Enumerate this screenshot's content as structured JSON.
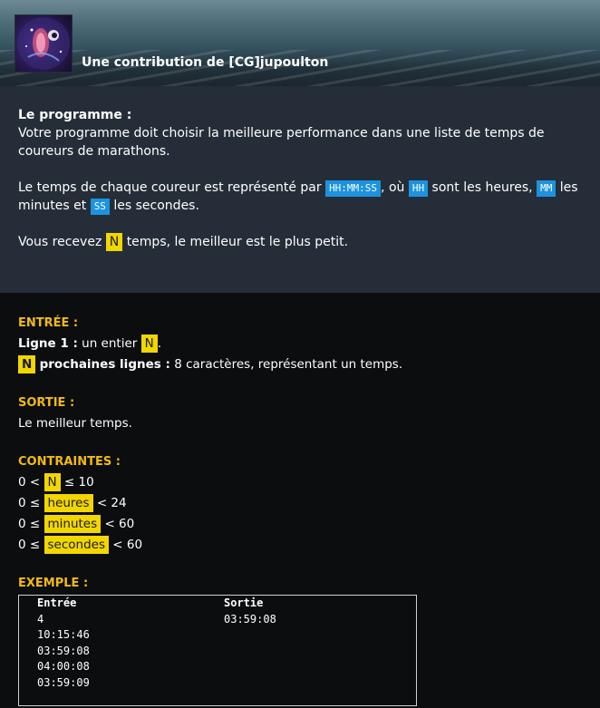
{
  "header": {
    "contribution": "Une contribution de [CG]jupoulton",
    "avatar_icon": "galaxy-creature-icon"
  },
  "statement": {
    "title": "Le programme :",
    "line1": "Votre programme doit choisir la meilleure performance dans une liste de temps de coureurs de marathons.",
    "p2_pre": "Le temps de chaque coureur est représenté par",
    "p2_code1": "HH:MM:SS",
    "p2_mid1": ", où",
    "p2_code2": "HH",
    "p2_mid2": "sont les heures,",
    "p2_code3": "MM",
    "p2_mid3": "les minutes et",
    "p2_code4": "SS",
    "p2_end": "les secondes.",
    "p3_pre": "Vous recevez",
    "p3_var": "N",
    "p3_end": "temps, le meilleur est le plus petit."
  },
  "io": {
    "input_title": "ENTRÉE :",
    "line1_label": "Ligne 1 :",
    "line1_text": "un entier",
    "line1_var": "N",
    "line1_end": ".",
    "next_var": "N",
    "next_label": "prochaines lignes :",
    "next_text": "8 caractères, représentant un temps.",
    "output_title": "SORTIE :",
    "output_text": "Le meilleur temps.",
    "constraints_title": "CONTRAINTES :",
    "constraints": [
      {
        "pre": "0 <",
        "var": "N",
        "post": "≤ 10"
      },
      {
        "pre": "0 ≤",
        "var": "heures",
        "post": "< 24"
      },
      {
        "pre": "0 ≤",
        "var": "minutes",
        "post": "< 60"
      },
      {
        "pre": "0 ≤",
        "var": "secondes",
        "post": "< 60"
      }
    ],
    "example_title": "EXEMPLE :",
    "example": {
      "input_header": "Entrée",
      "output_header": "Sortie",
      "input_lines": [
        "4",
        "10:15:46",
        "03:59:08",
        "04:00:08",
        "03:59:09"
      ],
      "output_lines": [
        "03:59:08"
      ]
    }
  }
}
